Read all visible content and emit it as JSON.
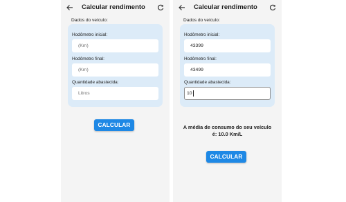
{
  "screens": [
    {
      "title": "Calcular rendimento",
      "section_label": "Dados do veículo:",
      "fields": [
        {
          "label": "Hodômetro inicial:",
          "value": "",
          "placeholder": "(Km)"
        },
        {
          "label": "Hodômetro final:",
          "value": "",
          "placeholder": "(Km)"
        },
        {
          "label": "Quantidade abastecida:",
          "value": "",
          "placeholder": "Litros"
        }
      ],
      "button_label": "CALCULAR"
    },
    {
      "title": "Calcular rendimento",
      "section_label": "Dados do veículo:",
      "fields": [
        {
          "label": "Hodômetro inicial:",
          "value": "43399",
          "placeholder": ""
        },
        {
          "label": "Hodômetro final:",
          "value": "43499",
          "placeholder": ""
        },
        {
          "label": "Quantidade abastecida:",
          "value": "10",
          "placeholder": ""
        }
      ],
      "result_line1": "A média de consumo do seu veículo",
      "result_line2": "é: 10.0 Km/L",
      "button_label": "CALCULAR"
    }
  ],
  "icons": {
    "back": "arrow-left-icon",
    "refresh": "refresh-icon"
  },
  "colors": {
    "card": "#dcebf8",
    "button": "#1e88e5",
    "screen_bg": "#f4f4f4"
  }
}
